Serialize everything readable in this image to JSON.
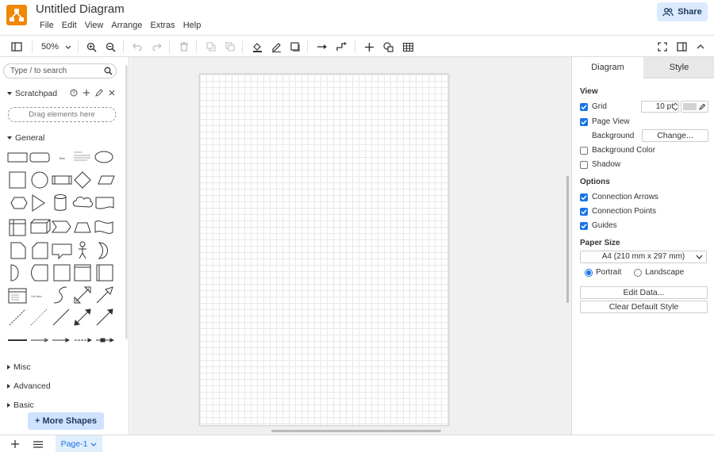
{
  "app": {
    "title": "Untitled Diagram",
    "accent_color": "#f08705",
    "menu": [
      "File",
      "Edit",
      "View",
      "Arrange",
      "Extras",
      "Help"
    ],
    "share_label": "Share"
  },
  "toolbar": {
    "zoom": "50%",
    "icons": [
      "sidebar-toggle-icon",
      "zoom-in-icon",
      "zoom-out-icon",
      "undo-icon",
      "redo-icon",
      "delete-icon",
      "to-front-icon",
      "to-back-icon",
      "fill-color-icon",
      "line-color-icon",
      "shadow-icon",
      "connection-icon",
      "waypoints-icon",
      "insert-icon",
      "shapes-icon",
      "table-icon",
      "fullscreen-icon",
      "format-panel-icon",
      "collapse-icon"
    ]
  },
  "left_panel": {
    "search_placeholder": "Type / to search",
    "scratchpad": {
      "label": "Scratchpad",
      "drop_hint": "Drag elements here"
    },
    "sections": [
      {
        "label": "General",
        "expanded": true
      },
      {
        "label": "Misc",
        "expanded": false
      },
      {
        "label": "Advanced",
        "expanded": false
      },
      {
        "label": "Basic",
        "expanded": false
      }
    ],
    "more_shapes_label": "More Shapes"
  },
  "right_panel": {
    "tabs": [
      "Diagram",
      "Style"
    ],
    "active_tab": "Diagram",
    "view_label": "View",
    "grid": {
      "label": "Grid",
      "checked": true,
      "size": "10 pt"
    },
    "page_view": {
      "label": "Page View",
      "checked": true
    },
    "background": {
      "label": "Background",
      "button": "Change..."
    },
    "background_color": {
      "label": "Background Color",
      "checked": false
    },
    "shadow": {
      "label": "Shadow",
      "checked": false
    },
    "options_label": "Options",
    "connection_arrows": {
      "label": "Connection Arrows",
      "checked": true
    },
    "connection_points": {
      "label": "Connection Points",
      "checked": true
    },
    "guides": {
      "label": "Guides",
      "checked": true
    },
    "paper_size_label": "Paper Size",
    "paper_size": "A4 (210 mm x 297 mm)",
    "orientation": {
      "portrait": "Portrait",
      "landscape": "Landscape",
      "selected": "portrait"
    },
    "edit_data_label": "Edit Data...",
    "clear_style_label": "Clear Default Style"
  },
  "footer": {
    "page_tab": "Page-1"
  }
}
